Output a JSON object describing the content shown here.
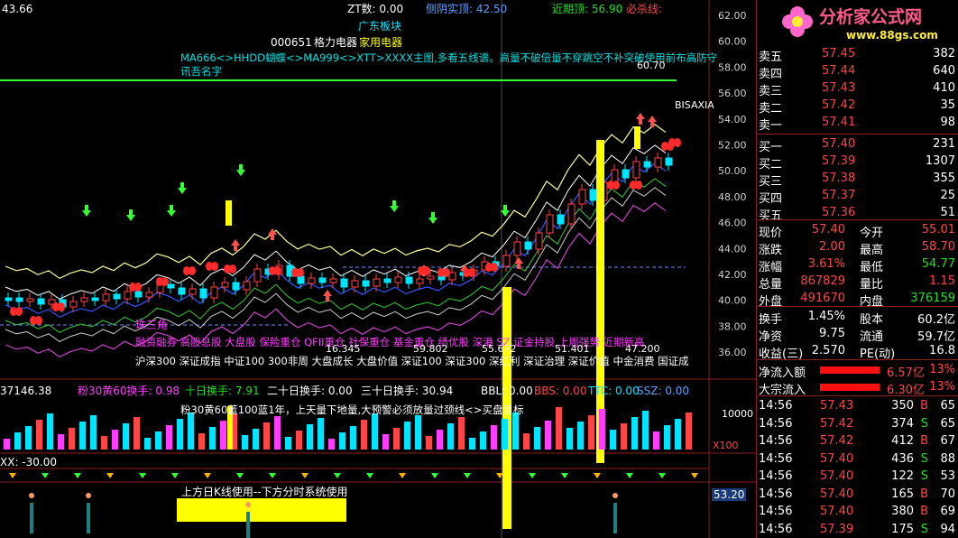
{
  "chart": {
    "top_left_value": "43.66",
    "zt_label": "ZT数: 0.00",
    "yang_label": "侧阴实顶: 42.50",
    "recent_top": "近期顶: 56.90",
    "must_kill": "必杀线:",
    "sector": "广东板块",
    "stock_code": "000651",
    "stock_name": "格力电器",
    "industry": "家用电器",
    "formula_line": "MA666<>HHDD蝴蝶<>MA999<>XTT>XXXX主图,多看五线谱。高量不破倍量不穿跳空不补突破使用前布高防守",
    "formula_line2": "讯吾名字",
    "price_tag_top": "60.70",
    "bisaxia": "BISAXIA",
    "zhusanjiao": "珠三角",
    "concepts_line1": "融资融券 高股息股 大盘股 保险重仓 QFII重仓 社保重仓 基金重仓 绩优股 深港 SZ 证金持股 上周强势 近期新高",
    "concepts_line2": "沪深300 深证成指 中证100 300非周 大盘成长 大盘价值 深证100 深证300 深红利 深证治理 深证价值 中金消费 国证成",
    "num_a": "16.345",
    "num_b": "59.802",
    "num_c": "55.672",
    "num_d": "51.401",
    "num_e": "47.200",
    "right_scale": [
      "62.00",
      "60.00",
      "58.00",
      "56.00",
      "54.00",
      "52.00",
      "50.00",
      "48.00",
      "46.00",
      "44.00",
      "42.00",
      "40.00",
      "38.00",
      "36.00"
    ],
    "panel2_header": {
      "val": "37146.38",
      "a": "粉30黄60换手: 0.98",
      "b": "十日换手: 7.91",
      "c": "二十日换手: 0.00",
      "d": "三十日换手: 30.94",
      "e": "BBL: 0.00",
      "f": "BBS: 0.00",
      "g": "TTC: 0.00",
      "h": "SSZ: 0.00"
    },
    "panel2_note": "粉30黄60蓝100蓝1年，上天量下地量,大预警必须放量过颈线<>买盘目标",
    "panel2_scale_top": "10000",
    "panel2_scale_x": "X100",
    "panel3_header": "XX: -30.00",
    "panel4_note": "上方日K线使用--下方分时系统使用",
    "panel4_scale": "53.20"
  },
  "quote": {
    "logo_text": "分析家公式网",
    "logo_url": "www.88gs.com",
    "asks": [
      {
        "label": "卖五",
        "price": "57.45",
        "vol": "382"
      },
      {
        "label": "卖四",
        "price": "57.44",
        "vol": "640"
      },
      {
        "label": "卖三",
        "price": "57.43",
        "vol": "410"
      },
      {
        "label": "卖二",
        "price": "57.42",
        "vol": "35"
      },
      {
        "label": "卖一",
        "price": "57.41",
        "vol": "98"
      }
    ],
    "bids": [
      {
        "label": "买一",
        "price": "57.40",
        "vol": "231"
      },
      {
        "label": "买二",
        "price": "57.39",
        "vol": "1307"
      },
      {
        "label": "买三",
        "price": "57.38",
        "vol": "355"
      },
      {
        "label": "买四",
        "price": "57.37",
        "vol": "25"
      },
      {
        "label": "买五",
        "price": "57.36",
        "vol": "51"
      }
    ],
    "stats": [
      {
        "l1": "现价",
        "v1": "57.40",
        "l2": "今开",
        "v2": "55.01"
      },
      {
        "l1": "涨跌",
        "v1": "2.00",
        "l2": "最高",
        "v2": "58.70"
      },
      {
        "l1": "涨幅",
        "v1": "3.61%",
        "l2": "最低",
        "v2": "54.77"
      },
      {
        "l1": "总量",
        "v1": "867829",
        "l2": "量比",
        "v2": "1.15"
      },
      {
        "l1": "外盘",
        "v1": "491670",
        "l2": "内盘",
        "v2": "376159"
      }
    ],
    "stats2": [
      {
        "l1": "换手",
        "v1": "1.45%",
        "l2": "股本",
        "v2": "60.2亿"
      },
      {
        "l1": "净资",
        "v1": "9.75",
        "l2": "流通",
        "v2": "59.7亿"
      },
      {
        "l1": "收益(三)",
        "v1": "2.570",
        "l2": "PE(动)",
        "v2": "16.8"
      }
    ],
    "flows": [
      {
        "label": "净流入额",
        "amount": "6.57亿",
        "pct": "13%"
      },
      {
        "label": "大宗流入",
        "amount": "6.30亿",
        "pct": "13%"
      }
    ],
    "trades": [
      {
        "time": "14:56",
        "price": "57.43",
        "vol": "350",
        "bs": "B",
        "n": "65"
      },
      {
        "time": "14:56",
        "price": "57.42",
        "vol": "374",
        "bs": "S",
        "n": "65"
      },
      {
        "time": "14:56",
        "price": "57.42",
        "vol": "412",
        "bs": "B",
        "n": "67"
      },
      {
        "time": "14:56",
        "price": "57.40",
        "vol": "436",
        "bs": "S",
        "n": "88"
      },
      {
        "time": "14:56",
        "price": "57.40",
        "vol": "122",
        "bs": "S",
        "n": "53"
      },
      {
        "time": "14:56",
        "price": "57.40",
        "vol": "165",
        "bs": "B",
        "n": "70"
      },
      {
        "time": "14:56",
        "price": "57.40",
        "vol": "380",
        "bs": "B",
        "n": "69"
      },
      {
        "time": "14:56",
        "price": "57.39",
        "vol": "175",
        "bs": "S",
        "n": "94"
      }
    ],
    "colors": {
      "up": "#ff4545",
      "down": "#20e020",
      "bar": "#ff1010",
      "border": "#8a1e1e"
    }
  }
}
